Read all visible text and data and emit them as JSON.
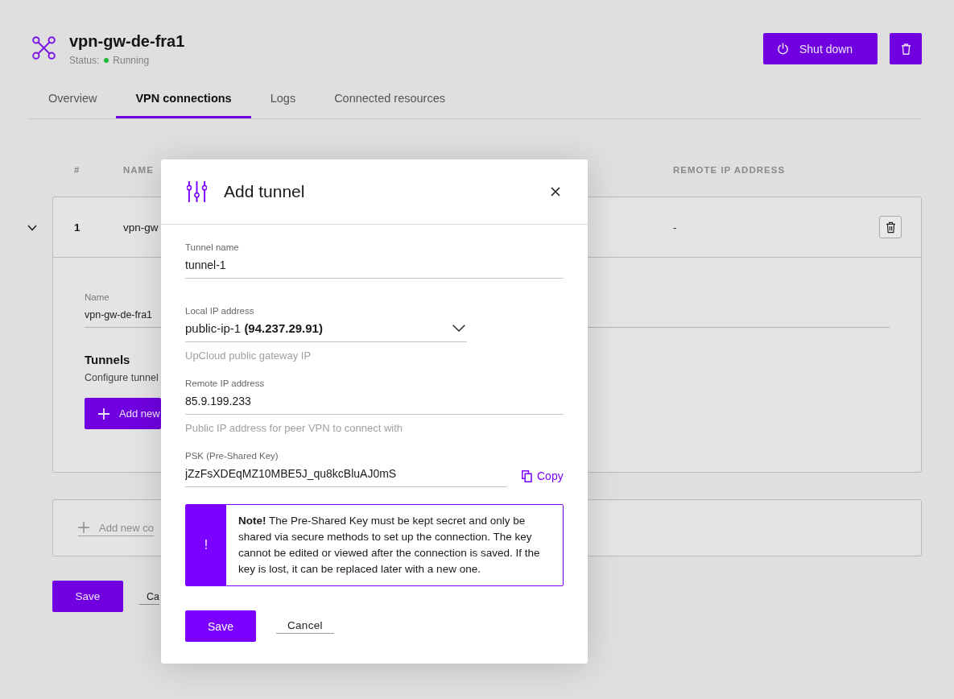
{
  "header": {
    "title": "vpn-gw-de-fra1",
    "status": {
      "label": "Status:",
      "value": "Running",
      "color": "#1fb83c"
    },
    "shutdown_button": "Shut down"
  },
  "tabs": [
    {
      "label": "Overview",
      "selected": false
    },
    {
      "label": "VPN connections",
      "selected": true
    },
    {
      "label": "Logs",
      "selected": false
    },
    {
      "label": "Connected resources",
      "selected": false
    }
  ],
  "table": {
    "columns": [
      "#",
      "NAME",
      "REMOTE IP ADDRESS"
    ],
    "rows": [
      {
        "number": "1",
        "name": "vpn-gw",
        "remote_ip": "-",
        "expanded": true,
        "details": {
          "name_label": "Name",
          "name_value": "vpn-gw-de-fra1",
          "tunnels_title": "Tunnels",
          "tunnels_description": "Configure tunnel",
          "add_button": "Add new"
        }
      }
    ]
  },
  "add_connection_link": "Add new co",
  "footer_buttons": [
    {
      "kind": "primary",
      "label": "Save"
    },
    {
      "kind": "link",
      "label": "Ca"
    }
  ],
  "modal": {
    "title": "Add tunnel",
    "fields": [
      {
        "kind": "text",
        "label": "Tunnel name",
        "value": "tunnel-1"
      },
      {
        "kind": "select",
        "label": "Local IP address",
        "value": "public-ip-1 **(94.237.29.91)**",
        "help": "UpCloud public gateway IP"
      },
      {
        "kind": "text",
        "label": "Remote IP address",
        "value": "85.9.199.233",
        "help": "Public IP address for peer VPN to connect with"
      },
      {
        "kind": "secret",
        "label": "PSK (Pre-Shared Key)",
        "value": "jZzFsXDEqMZ10MBE5J_qu8kcBluAJ0mS",
        "action": "Copy"
      }
    ],
    "note": {
      "mark": "!",
      "text": "**Note!** The Pre-Shared Key must be kept secret and only be shared via secure methods to set up the connection. The key cannot be edited or viewed after the connection is saved. If the key is lost, it can be replaced later with a new one."
    },
    "buttons": [
      {
        "kind": "primary",
        "label": "Save"
      },
      {
        "kind": "link",
        "label": "Cancel"
      }
    ]
  }
}
